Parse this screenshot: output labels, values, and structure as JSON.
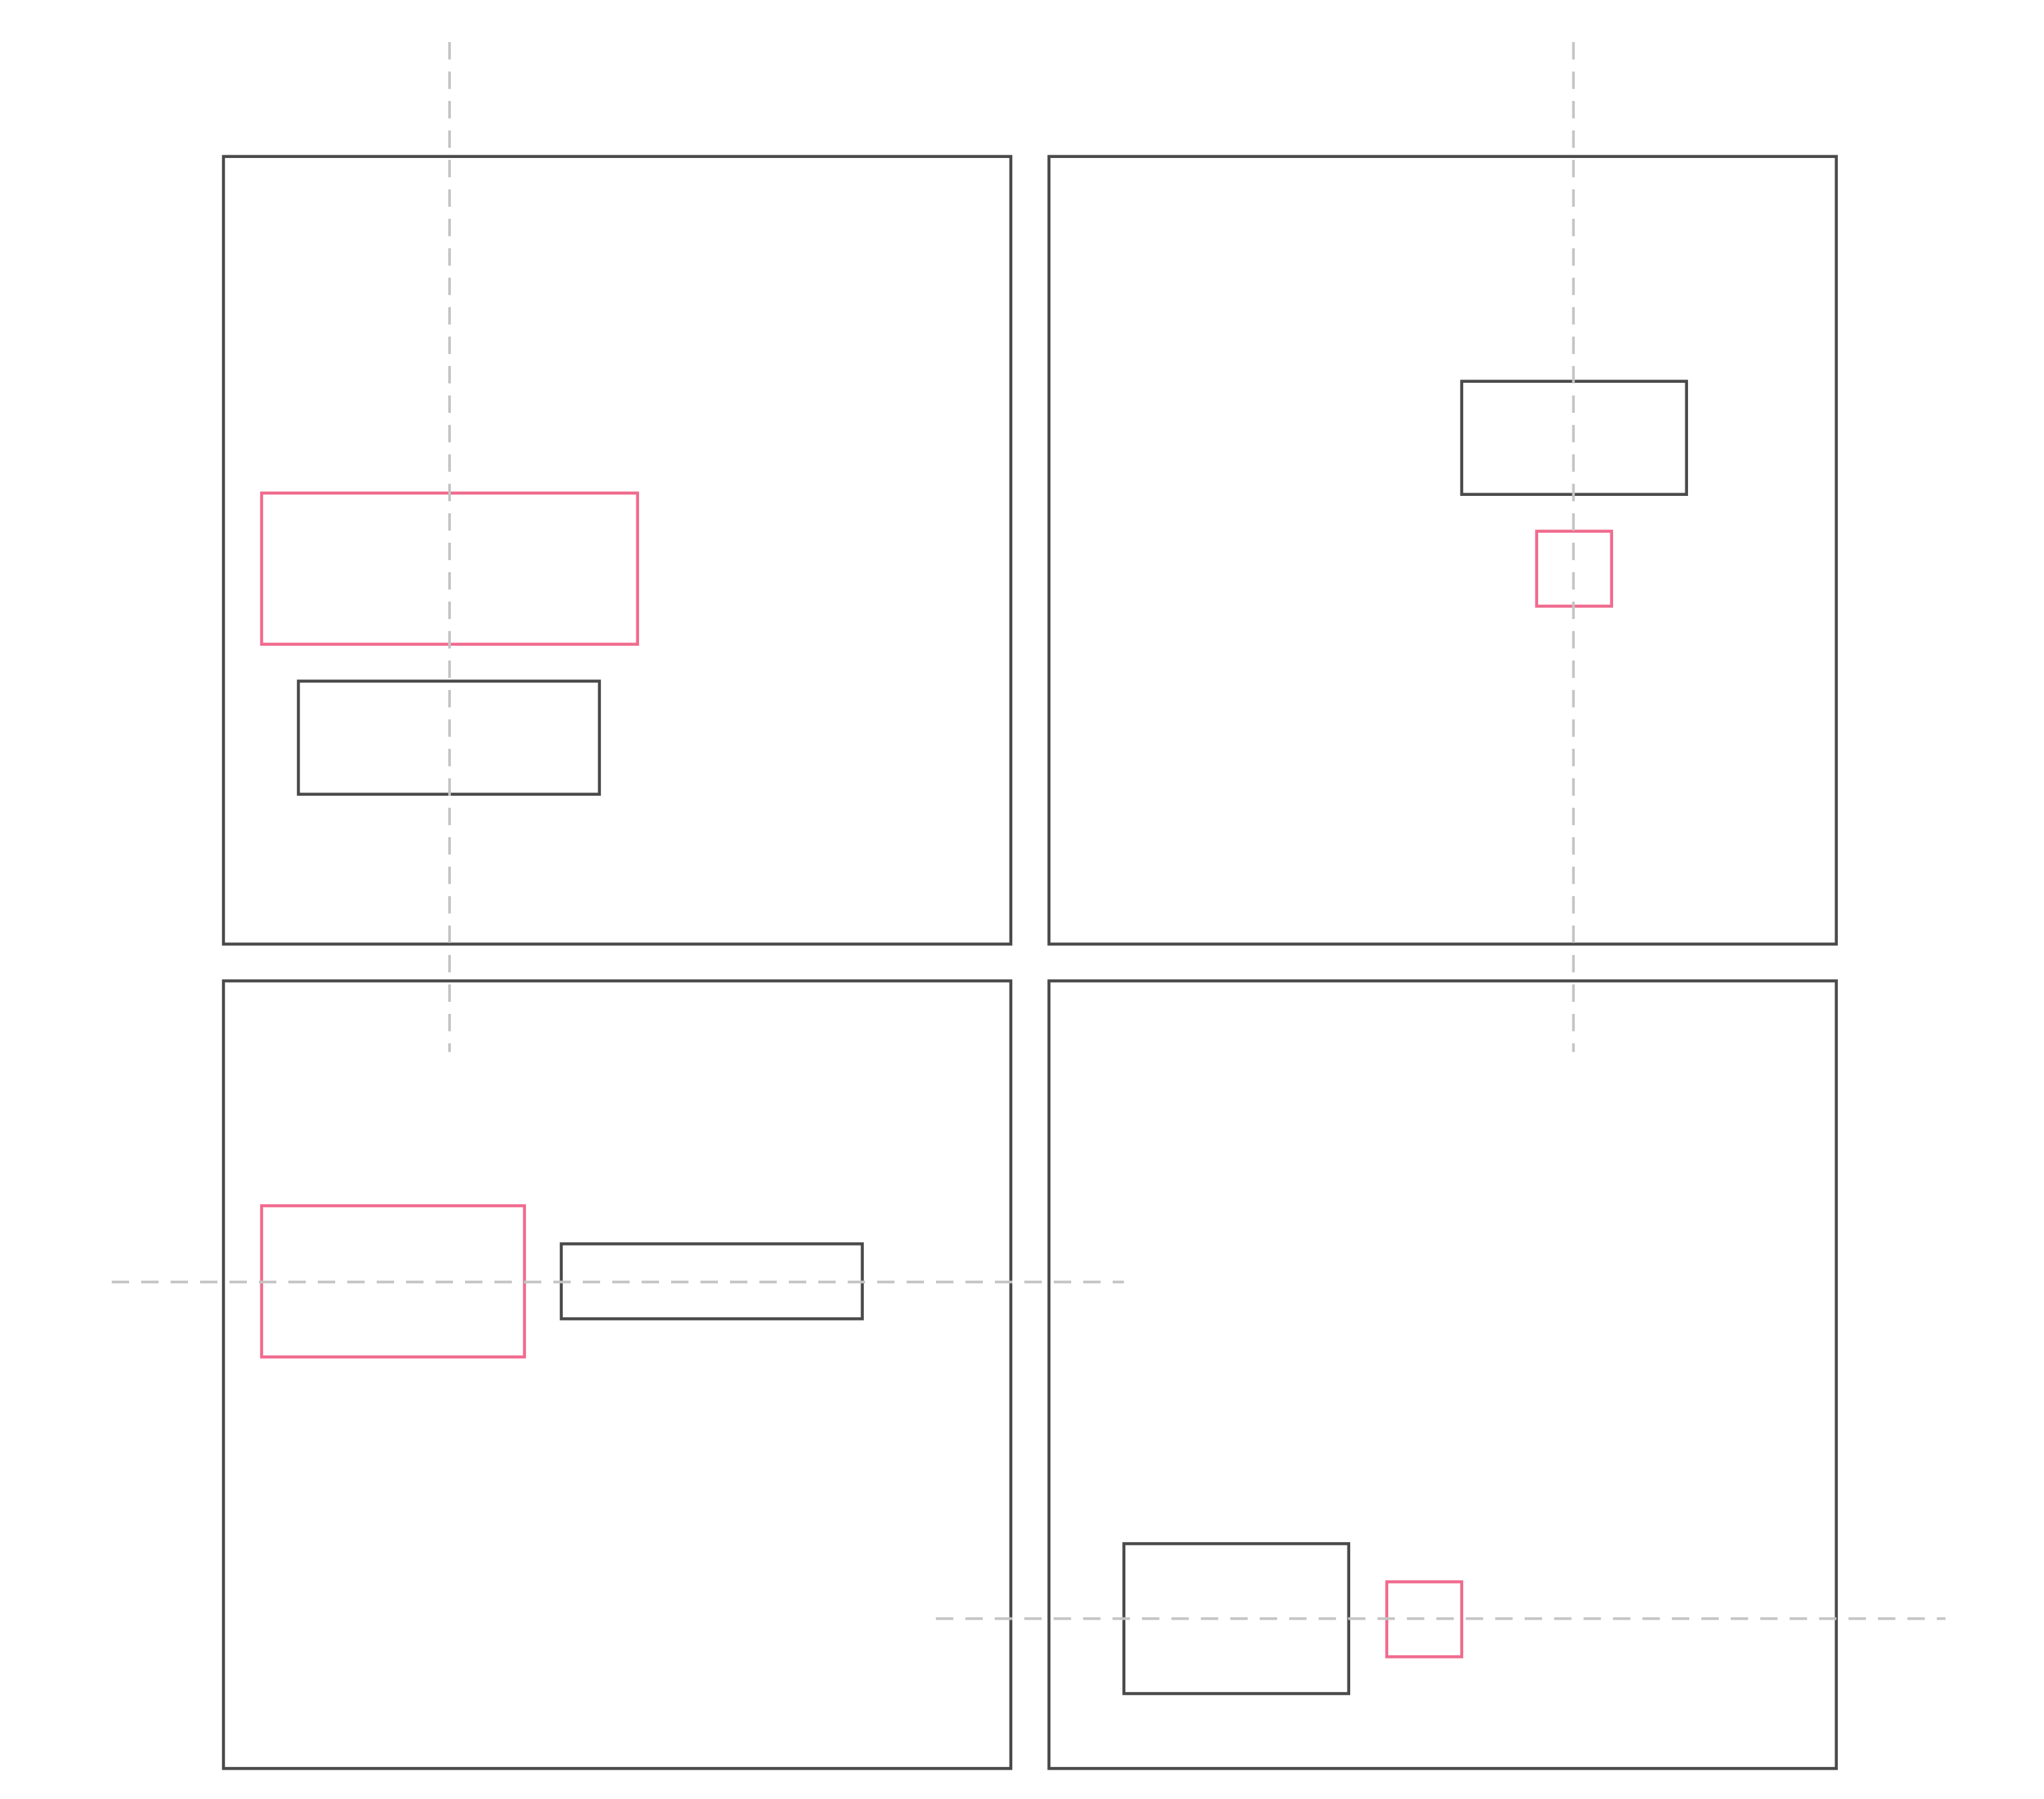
{
  "colors": {
    "background": "#ffffff",
    "panel_stroke": "#4a4a4a",
    "reference_box_stroke": "#4a4a4a",
    "highlight_box_stroke": "#f06b8e",
    "guide_line": "#c4c4c4"
  },
  "panels": [
    {
      "id": "top-left",
      "guide_orientation": "vertical",
      "highlight_box": {
        "role": "pink-rectangle"
      },
      "reference_box": {
        "role": "dark-rectangle"
      }
    },
    {
      "id": "top-right",
      "guide_orientation": "vertical",
      "highlight_box": {
        "role": "pink-square"
      },
      "reference_box": {
        "role": "dark-rectangle"
      }
    },
    {
      "id": "bottom-left",
      "guide_orientation": "horizontal",
      "highlight_box": {
        "role": "pink-rectangle"
      },
      "reference_box": {
        "role": "dark-rectangle"
      }
    },
    {
      "id": "bottom-right",
      "guide_orientation": "horizontal",
      "highlight_box": {
        "role": "pink-square"
      },
      "reference_box": {
        "role": "dark-rectangle"
      }
    }
  ]
}
